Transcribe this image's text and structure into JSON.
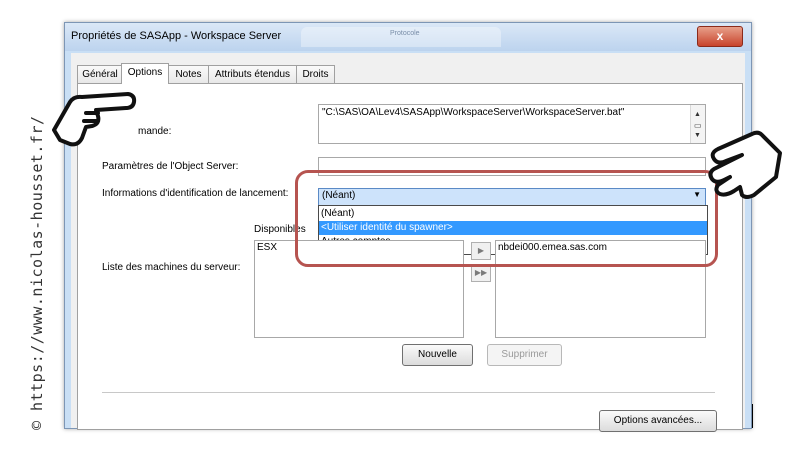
{
  "watermark": "© https://www.nicolas-housset.fr/",
  "window": {
    "title": "Propriétés de SASApp - Workspace Server",
    "ghost_title": "Protocole",
    "close_label": "x"
  },
  "tabs": [
    {
      "label": "Général",
      "active": false
    },
    {
      "label": "Options",
      "active": true
    },
    {
      "label": "Notes",
      "active": false
    },
    {
      "label": "Attributs étendus",
      "active": false
    },
    {
      "label": "Droits",
      "active": false
    }
  ],
  "form": {
    "commande_label": "mande:",
    "commande_value": "\"C:\\SAS\\OA\\Lev4\\SASApp\\WorkspaceServer\\WorkspaceServer.bat\"",
    "object_server_label": "Paramètres de l'Object Server:",
    "launch_creds_label": "Informations d'identification de lancement:",
    "launch_creds_value": "(Néant)",
    "launch_creds_options": [
      "(Néant)",
      "<Utiliser identité du spawner>",
      "Autres comptes..."
    ],
    "launch_creds_highlighted_index": 1,
    "disponibles_label": "Disponibles",
    "machines_label": "Liste des machines du serveur:",
    "available_items": [
      "ESX"
    ],
    "selected_items_partial": "nbdei000.emea.sas.com"
  },
  "buttons": {
    "nouvelle": "Nouvelle",
    "supprimer": "Supprimer",
    "options_avancees": "Options avancées..."
  },
  "colors": {
    "highlight_border": "#b65450",
    "selection": "#3399ff",
    "close_button": "#c8442c"
  },
  "icons": {
    "pointing_hand_left": "hand-pointing-icon",
    "pointing_hand_right": "hand-pointing-icon"
  }
}
